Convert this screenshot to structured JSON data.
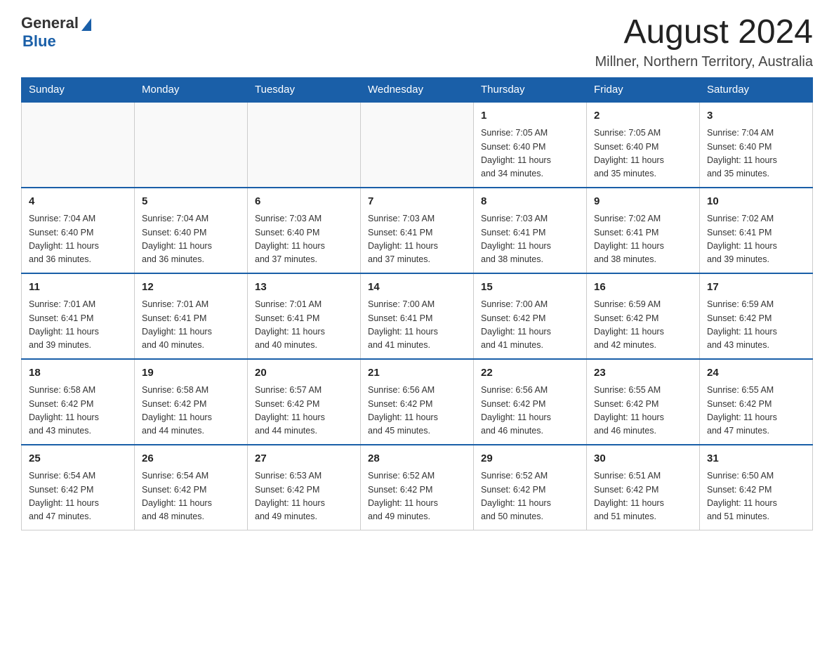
{
  "logo": {
    "general": "General",
    "blue": "Blue"
  },
  "title": "August 2024",
  "location": "Millner, Northern Territory, Australia",
  "days_of_week": [
    "Sunday",
    "Monday",
    "Tuesday",
    "Wednesday",
    "Thursday",
    "Friday",
    "Saturday"
  ],
  "weeks": [
    [
      {
        "day": "",
        "info": ""
      },
      {
        "day": "",
        "info": ""
      },
      {
        "day": "",
        "info": ""
      },
      {
        "day": "",
        "info": ""
      },
      {
        "day": "1",
        "info": "Sunrise: 7:05 AM\nSunset: 6:40 PM\nDaylight: 11 hours\nand 34 minutes."
      },
      {
        "day": "2",
        "info": "Sunrise: 7:05 AM\nSunset: 6:40 PM\nDaylight: 11 hours\nand 35 minutes."
      },
      {
        "day": "3",
        "info": "Sunrise: 7:04 AM\nSunset: 6:40 PM\nDaylight: 11 hours\nand 35 minutes."
      }
    ],
    [
      {
        "day": "4",
        "info": "Sunrise: 7:04 AM\nSunset: 6:40 PM\nDaylight: 11 hours\nand 36 minutes."
      },
      {
        "day": "5",
        "info": "Sunrise: 7:04 AM\nSunset: 6:40 PM\nDaylight: 11 hours\nand 36 minutes."
      },
      {
        "day": "6",
        "info": "Sunrise: 7:03 AM\nSunset: 6:40 PM\nDaylight: 11 hours\nand 37 minutes."
      },
      {
        "day": "7",
        "info": "Sunrise: 7:03 AM\nSunset: 6:41 PM\nDaylight: 11 hours\nand 37 minutes."
      },
      {
        "day": "8",
        "info": "Sunrise: 7:03 AM\nSunset: 6:41 PM\nDaylight: 11 hours\nand 38 minutes."
      },
      {
        "day": "9",
        "info": "Sunrise: 7:02 AM\nSunset: 6:41 PM\nDaylight: 11 hours\nand 38 minutes."
      },
      {
        "day": "10",
        "info": "Sunrise: 7:02 AM\nSunset: 6:41 PM\nDaylight: 11 hours\nand 39 minutes."
      }
    ],
    [
      {
        "day": "11",
        "info": "Sunrise: 7:01 AM\nSunset: 6:41 PM\nDaylight: 11 hours\nand 39 minutes."
      },
      {
        "day": "12",
        "info": "Sunrise: 7:01 AM\nSunset: 6:41 PM\nDaylight: 11 hours\nand 40 minutes."
      },
      {
        "day": "13",
        "info": "Sunrise: 7:01 AM\nSunset: 6:41 PM\nDaylight: 11 hours\nand 40 minutes."
      },
      {
        "day": "14",
        "info": "Sunrise: 7:00 AM\nSunset: 6:41 PM\nDaylight: 11 hours\nand 41 minutes."
      },
      {
        "day": "15",
        "info": "Sunrise: 7:00 AM\nSunset: 6:42 PM\nDaylight: 11 hours\nand 41 minutes."
      },
      {
        "day": "16",
        "info": "Sunrise: 6:59 AM\nSunset: 6:42 PM\nDaylight: 11 hours\nand 42 minutes."
      },
      {
        "day": "17",
        "info": "Sunrise: 6:59 AM\nSunset: 6:42 PM\nDaylight: 11 hours\nand 43 minutes."
      }
    ],
    [
      {
        "day": "18",
        "info": "Sunrise: 6:58 AM\nSunset: 6:42 PM\nDaylight: 11 hours\nand 43 minutes."
      },
      {
        "day": "19",
        "info": "Sunrise: 6:58 AM\nSunset: 6:42 PM\nDaylight: 11 hours\nand 44 minutes."
      },
      {
        "day": "20",
        "info": "Sunrise: 6:57 AM\nSunset: 6:42 PM\nDaylight: 11 hours\nand 44 minutes."
      },
      {
        "day": "21",
        "info": "Sunrise: 6:56 AM\nSunset: 6:42 PM\nDaylight: 11 hours\nand 45 minutes."
      },
      {
        "day": "22",
        "info": "Sunrise: 6:56 AM\nSunset: 6:42 PM\nDaylight: 11 hours\nand 46 minutes."
      },
      {
        "day": "23",
        "info": "Sunrise: 6:55 AM\nSunset: 6:42 PM\nDaylight: 11 hours\nand 46 minutes."
      },
      {
        "day": "24",
        "info": "Sunrise: 6:55 AM\nSunset: 6:42 PM\nDaylight: 11 hours\nand 47 minutes."
      }
    ],
    [
      {
        "day": "25",
        "info": "Sunrise: 6:54 AM\nSunset: 6:42 PM\nDaylight: 11 hours\nand 47 minutes."
      },
      {
        "day": "26",
        "info": "Sunrise: 6:54 AM\nSunset: 6:42 PM\nDaylight: 11 hours\nand 48 minutes."
      },
      {
        "day": "27",
        "info": "Sunrise: 6:53 AM\nSunset: 6:42 PM\nDaylight: 11 hours\nand 49 minutes."
      },
      {
        "day": "28",
        "info": "Sunrise: 6:52 AM\nSunset: 6:42 PM\nDaylight: 11 hours\nand 49 minutes."
      },
      {
        "day": "29",
        "info": "Sunrise: 6:52 AM\nSunset: 6:42 PM\nDaylight: 11 hours\nand 50 minutes."
      },
      {
        "day": "30",
        "info": "Sunrise: 6:51 AM\nSunset: 6:42 PM\nDaylight: 11 hours\nand 51 minutes."
      },
      {
        "day": "31",
        "info": "Sunrise: 6:50 AM\nSunset: 6:42 PM\nDaylight: 11 hours\nand 51 minutes."
      }
    ]
  ]
}
